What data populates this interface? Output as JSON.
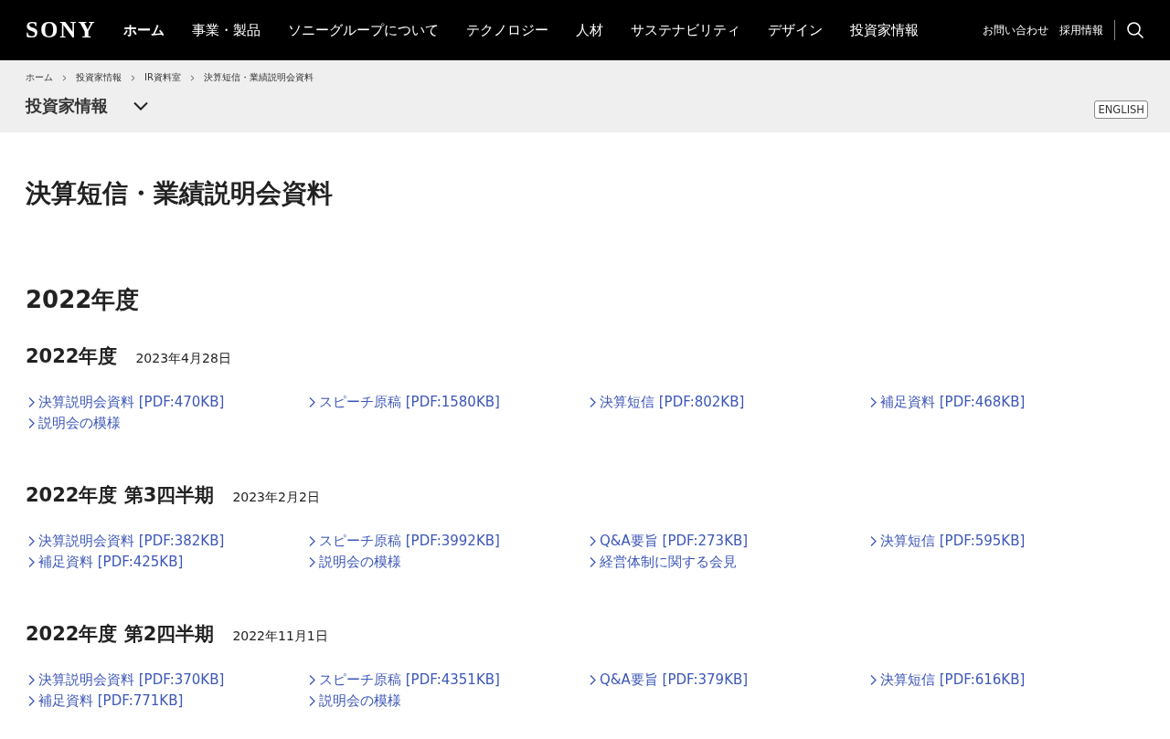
{
  "header": {
    "logo": "SONY",
    "nav": [
      {
        "label": "ホーム",
        "selected": true
      },
      {
        "label": "事業・製品",
        "selected": false
      },
      {
        "label": "ソニーグループについて",
        "selected": false
      },
      {
        "label": "テクノロジー",
        "selected": false
      },
      {
        "label": "人材",
        "selected": false
      },
      {
        "label": "サステナビリティ",
        "selected": false
      },
      {
        "label": "デザイン",
        "selected": false
      },
      {
        "label": "投資家情報",
        "selected": false
      }
    ],
    "utility": [
      "お問い合わせ",
      "採用情報"
    ]
  },
  "breadcrumb": [
    "ホーム",
    "投資家情報",
    "IR資料室",
    "決算短信・業績説明会資料"
  ],
  "section_menu": {
    "label": "投資家情報",
    "expanded": false
  },
  "language_button": "ENGLISH",
  "page_title": "決算短信・業績説明会資料",
  "fiscal_year": "2022年度",
  "sections": [
    {
      "title": "2022年度",
      "date": "2023年4月28日",
      "links": [
        "決算説明会資料 [PDF:470KB]",
        "スピーチ原稿 [PDF:1580KB]",
        "決算短信 [PDF:802KB]",
        "補足資料 [PDF:468KB]",
        "説明会の模様"
      ]
    },
    {
      "title": "2022年度 第3四半期",
      "date": "2023年2月2日",
      "links": [
        "決算説明会資料 [PDF:382KB]",
        "スピーチ原稿 [PDF:3992KB]",
        "Q&A要旨 [PDF:273KB]",
        "決算短信 [PDF:595KB]",
        "補足資料 [PDF:425KB]",
        "説明会の模様",
        "経営体制に関する会見"
      ]
    },
    {
      "title": "2022年度 第2四半期",
      "date": "2022年11月1日",
      "links": [
        "決算説明会資料 [PDF:370KB]",
        "スピーチ原稿 [PDF:4351KB]",
        "Q&A要旨 [PDF:379KB]",
        "決算短信 [PDF:616KB]",
        "補足資料 [PDF:771KB]",
        "説明会の模様"
      ]
    }
  ]
}
